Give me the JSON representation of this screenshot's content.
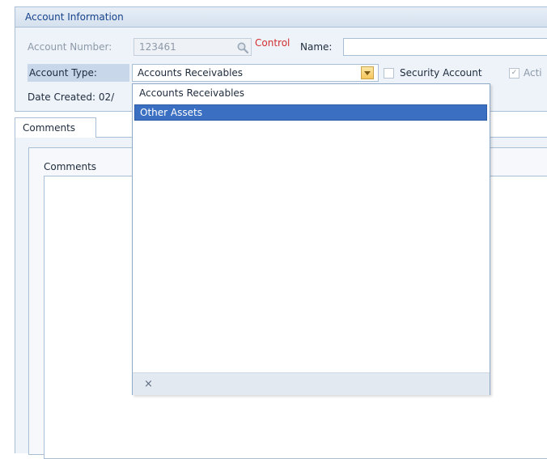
{
  "panel": {
    "title": "Account Information"
  },
  "form": {
    "account_number_label": "Account Number:",
    "account_number_value": "123461",
    "control_label": "Control",
    "name_label": "Name:",
    "name_value": "",
    "account_type_label": "Account Type:",
    "account_type_value": "Accounts Receivables",
    "security_account_label": "Security Account",
    "active_label": "Acti",
    "date_created_label": "Date Created: 02/"
  },
  "tabs": [
    {
      "label": "Comments"
    }
  ],
  "comments_panel": {
    "title": "Comments"
  },
  "dropdown": {
    "options": [
      "Accounts Receivables",
      "Other Assets"
    ],
    "highlighted": "Other Assets",
    "clear_glyph": "×"
  },
  "colors": {
    "accent": "#3a6fc2",
    "control_label": "#d22f2f",
    "panel_border": "#a9bfd6"
  },
  "icons": [
    "search-icon",
    "chevron-down-icon",
    "close-icon"
  ]
}
